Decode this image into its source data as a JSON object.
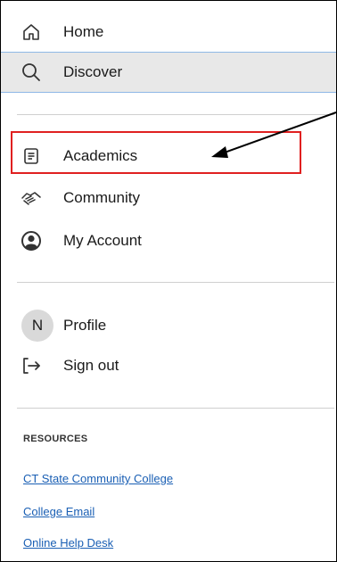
{
  "nav": {
    "home": {
      "label": "Home",
      "icon": "home-icon"
    },
    "discover": {
      "label": "Discover",
      "icon": "search-icon"
    },
    "academics": {
      "label": "Academics",
      "icon": "book-icon"
    },
    "community": {
      "label": "Community",
      "icon": "handshake-icon"
    },
    "my_account": {
      "label": "My Account",
      "icon": "account-circle-icon"
    }
  },
  "user": {
    "avatar_initial": "N",
    "profile_label": "Profile",
    "sign_out_label": "Sign out"
  },
  "resources": {
    "heading": "RESOURCES",
    "links": [
      "CT State Community College",
      "College Email",
      "Online Help Desk"
    ]
  },
  "colors": {
    "highlight_border": "#e02020",
    "selected_background": "#e8e8e8",
    "selected_border": "#8fb8e6",
    "link": "#1a5fb4"
  }
}
